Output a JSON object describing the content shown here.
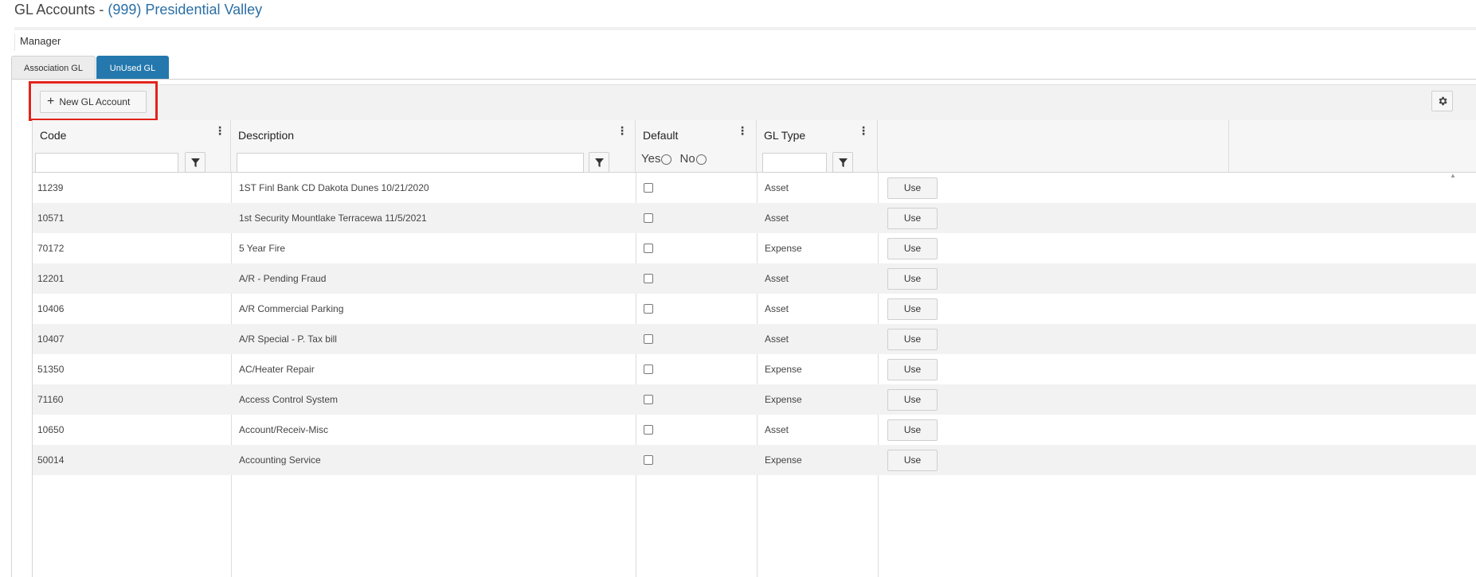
{
  "page": {
    "title_prefix": "GL Accounts - ",
    "association": "(999) Presidential Valley",
    "manager_label": "Manager"
  },
  "tabs": [
    {
      "label": "Association GL",
      "active": false
    },
    {
      "label": "UnUsed GL",
      "active": true
    }
  ],
  "toolbar": {
    "new_button_label": "New GL Account",
    "new_button_icon": "plus-icon",
    "settings_icon": "gear-icon"
  },
  "columns": {
    "code": "Code",
    "description": "Description",
    "default": "Default",
    "gl_type": "GL Type"
  },
  "filters": {
    "default_yes": "Yes",
    "default_no": "No",
    "filter_icon": "filter-icon"
  },
  "rows": [
    {
      "code": "11239",
      "description": "1ST Finl Bank CD Dakota Dunes 10/21/2020",
      "default": false,
      "gl_type": "Asset",
      "action": "Use"
    },
    {
      "code": "10571",
      "description": "1st Security Mountlake Terracewa 11/5/2021",
      "default": false,
      "gl_type": "Asset",
      "action": "Use"
    },
    {
      "code": "70172",
      "description": "5 Year Fire",
      "default": false,
      "gl_type": "Expense",
      "action": "Use"
    },
    {
      "code": "12201",
      "description": "A/R - Pending Fraud",
      "default": false,
      "gl_type": "Asset",
      "action": "Use"
    },
    {
      "code": "10406",
      "description": "A/R Commercial Parking",
      "default": false,
      "gl_type": "Asset",
      "action": "Use"
    },
    {
      "code": "10407",
      "description": "A/R Special - P. Tax bill",
      "default": false,
      "gl_type": "Asset",
      "action": "Use"
    },
    {
      "code": "51350",
      "description": "AC/Heater Repair",
      "default": false,
      "gl_type": "Expense",
      "action": "Use"
    },
    {
      "code": "71160",
      "description": "Access Control System",
      "default": false,
      "gl_type": "Expense",
      "action": "Use"
    },
    {
      "code": "10650",
      "description": "Account/Receiv-Misc",
      "default": false,
      "gl_type": "Asset",
      "action": "Use"
    },
    {
      "code": "50014",
      "description": "Accounting Service",
      "default": false,
      "gl_type": "Expense",
      "action": "Use"
    }
  ],
  "colors": {
    "accent": "#2478ad",
    "association_link": "#2a6fa6",
    "highlight_border": "#e2231a"
  }
}
